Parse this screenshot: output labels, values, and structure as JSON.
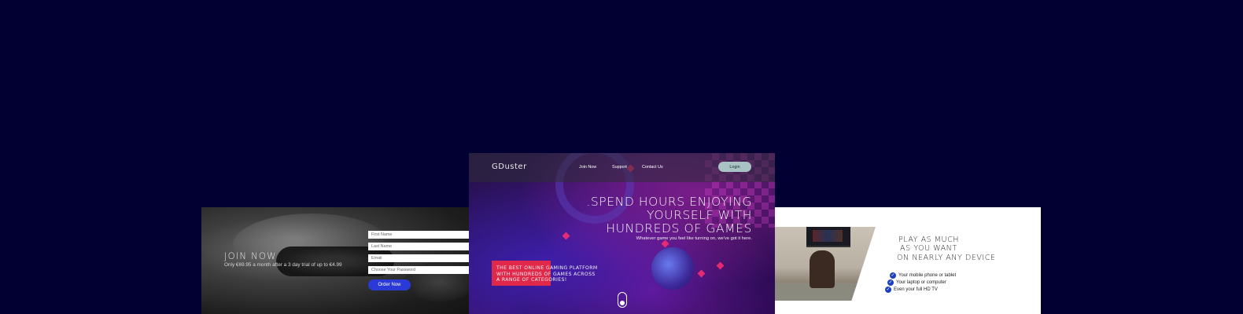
{
  "join_panel": {
    "title": "JOIN NOW",
    "subtitle": "Only €69.95 a month after a 3 day trial of up to €4.99",
    "fields": [
      {
        "placeholder": "First Name"
      },
      {
        "placeholder": "Last Name"
      },
      {
        "placeholder": "Email"
      },
      {
        "placeholder": "Choose Your Password"
      }
    ],
    "order_button": "Order Now",
    "colors": {
      "button": "#2b3ad6"
    }
  },
  "hero": {
    "logo": "GDuster",
    "nav": [
      "Join Now",
      "Support",
      "Contact Us"
    ],
    "login_button": "Login",
    "headline_lines": [
      ".SPEND HOURS ENJOYING",
      "YOURSELF WITH",
      "HUNDREDS OF GAMES"
    ],
    "tagline": "Whatever game you feel like turning on, we've got it here.",
    "promo_lines": [
      "THE BEST ONLINE GAMING PLATFORM",
      "WITH HUNDREDS OF GAMES ACROSS",
      "A RANGE OF CATEGORIES!"
    ],
    "colors": {
      "promo_box": "#e0284a",
      "login": "#a9c3c4"
    }
  },
  "devices_panel": {
    "headline_lines": [
      "PLAY AS MUCH",
      "AS YOU WANT",
      "ON NEARLY ANY DEVICE"
    ],
    "features": [
      "Your mobile phone or tablet",
      "Your laptop or computer",
      "Even your full HD TV"
    ],
    "colors": {
      "check": "#1d3fbf"
    }
  }
}
